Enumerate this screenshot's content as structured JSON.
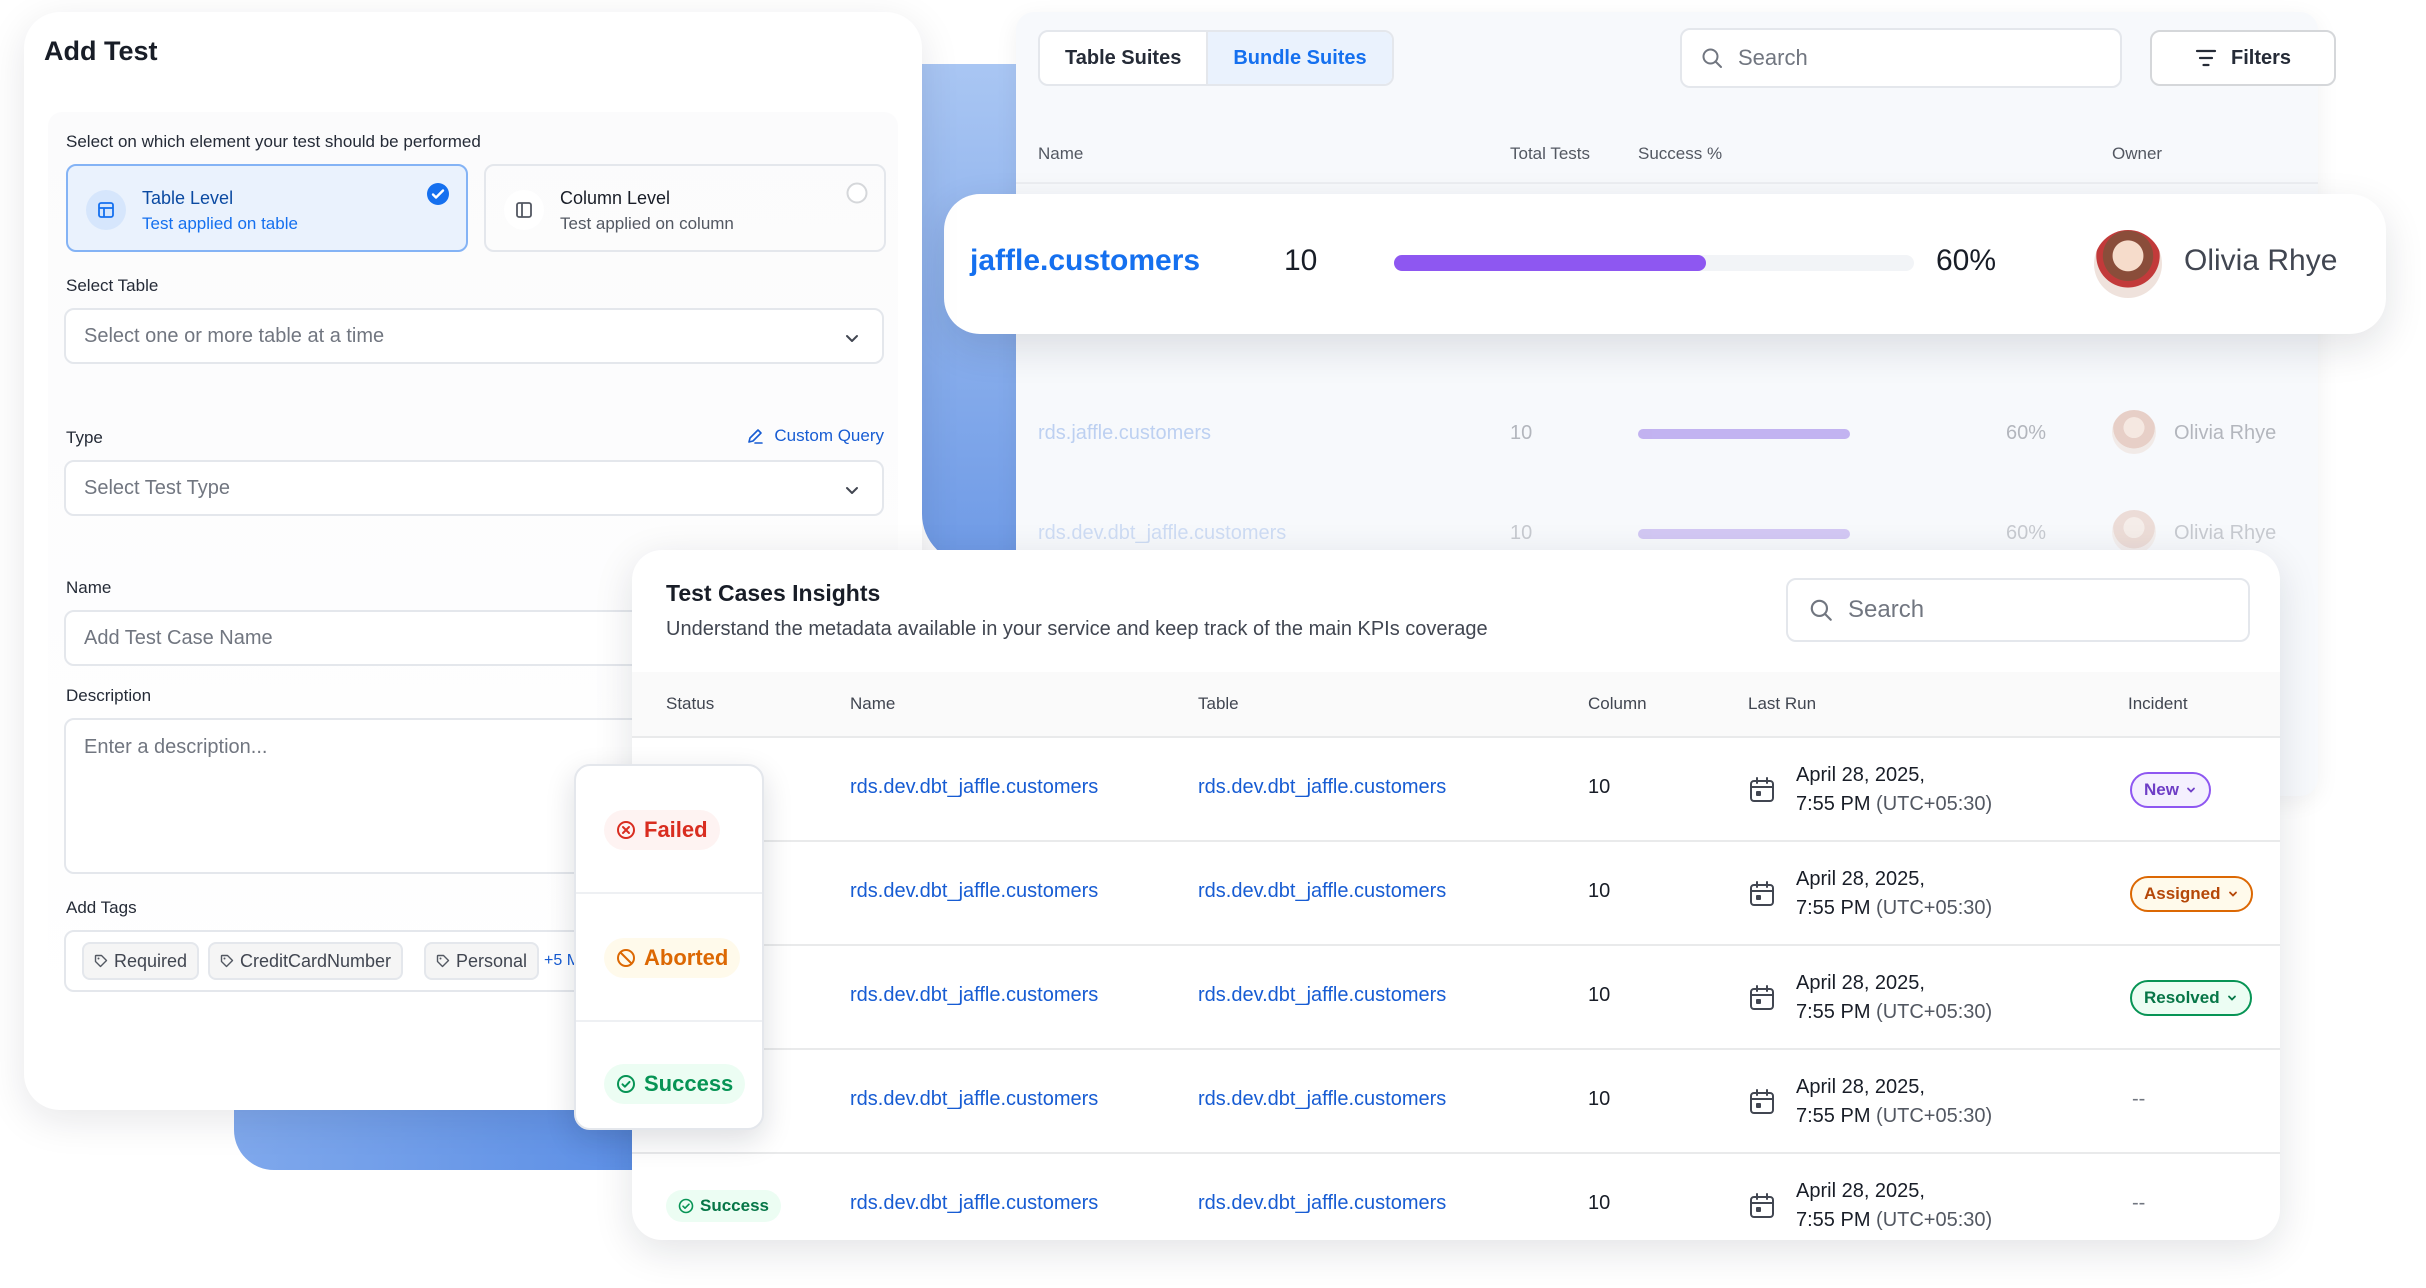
{
  "suites": {
    "tabs": [
      "Table Suites",
      "Bundle Suites"
    ],
    "search_placeholder": "Search",
    "filters_label": "Filters",
    "columns": [
      "Name",
      "Total Tests",
      "Success %",
      "Owner"
    ],
    "highlight": {
      "name": "jaffle.customers",
      "total": "10",
      "success": "60%",
      "success_value": 0.6,
      "owner": "Olivia Rhye"
    },
    "rows": [
      {
        "name": "rds.jaffle.customers",
        "total": "10",
        "success": "60%",
        "owner": "Olivia Rhye"
      },
      {
        "name": "rds.dev.dbt_jaffle.customers",
        "total": "10",
        "success": "60%",
        "owner": "Olivia Rhye"
      }
    ]
  },
  "add_test": {
    "title": "Add Test",
    "element_prompt": "Select on which element your test should be performed",
    "options": [
      {
        "title": "Table Level",
        "subtitle": "Test applied on table"
      },
      {
        "title": "Column Level",
        "subtitle": "Test applied on column"
      }
    ],
    "select_table_label": "Select Table",
    "select_table_placeholder": "Select one or more table at a time",
    "type_label": "Type",
    "custom_query": "Custom Query",
    "type_placeholder": "Select Test Type",
    "name_label": "Name",
    "name_placeholder": "Add Test Case Name",
    "description_label": "Description",
    "description_placeholder": "Enter a description...",
    "tags_label": "Add Tags",
    "tags": [
      "Required",
      "CreditCardNumber",
      "Personal"
    ],
    "more_tags": "+5 M"
  },
  "status_dropdown": {
    "items": [
      "Failed",
      "Aborted",
      "Success"
    ]
  },
  "insights": {
    "title": "Test Cases Insights",
    "subtitle": "Understand the metadata available in your service and keep track of the main KPIs coverage",
    "search_placeholder": "Search",
    "columns": [
      "Status",
      "Name",
      "Table",
      "Column",
      "Last Run",
      "Incident"
    ],
    "rows": [
      {
        "name": "rds.dev.dbt_jaffle.customers",
        "table": "rds.dev.dbt_jaffle.customers",
        "column": "10",
        "date": "April 28, 2025,",
        "time": "7:55 PM",
        "tz": "(UTC+05:30)",
        "incident": "New"
      },
      {
        "name": "rds.dev.dbt_jaffle.customers",
        "table": "rds.dev.dbt_jaffle.customers",
        "column": "10",
        "date": "April 28, 2025,",
        "time": "7:55 PM",
        "tz": "(UTC+05:30)",
        "incident": "Assigned"
      },
      {
        "name": "rds.dev.dbt_jaffle.customers",
        "table": "rds.dev.dbt_jaffle.customers",
        "column": "10",
        "date": "April 28, 2025,",
        "time": "7:55 PM",
        "tz": "(UTC+05:30)",
        "incident": "Resolved"
      },
      {
        "name": "rds.dev.dbt_jaffle.customers",
        "table": "rds.dev.dbt_jaffle.customers",
        "column": "10",
        "date": "April 28, 2025,",
        "time": "7:55 PM",
        "tz": "(UTC+05:30)",
        "incident": "--"
      },
      {
        "status": "Success",
        "name": "rds.dev.dbt_jaffle.customers",
        "table": "rds.dev.dbt_jaffle.customers",
        "column": "10",
        "date": "April 28, 2025,",
        "time": "7:55 PM",
        "tz": "(UTC+05:30)",
        "incident": "--"
      }
    ]
  },
  "colors": {
    "primary": "#1570ef",
    "failed": "#d92d20",
    "aborted": "#dc6803",
    "success": "#079455",
    "purple": "#8e57f1"
  }
}
